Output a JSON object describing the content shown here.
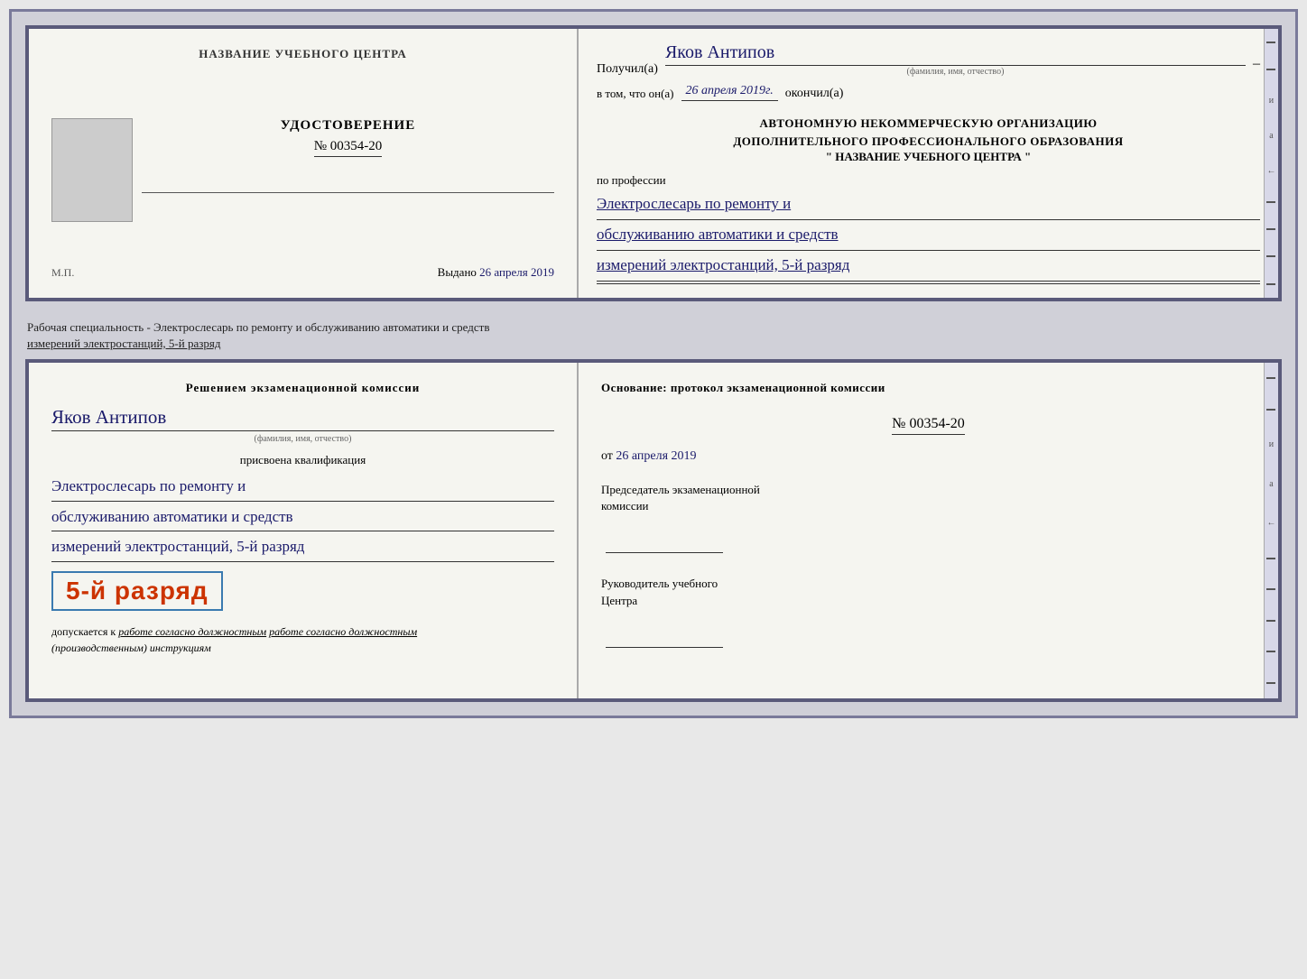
{
  "page": {
    "bg_color": "#d0d0d8"
  },
  "top_doc": {
    "left": {
      "org_name": "НАЗВАНИЕ УЧЕБНОГО ЦЕНТРА",
      "cert_title": "УДОСТОВЕРЕНИЕ",
      "cert_number": "№ 00354-20",
      "issued_label": "Выдано",
      "issued_date": "26 апреля 2019",
      "mp_label": "М.П."
    },
    "right": {
      "recipient_label": "Получил(а)",
      "recipient_name": "Яков Антипов",
      "fio_sub": "(фамилия, имя, отчество)",
      "date_prefix": "в том, что он(а)",
      "date_value": "26 апреля 2019г.",
      "date_suffix": "окончил(а)",
      "org_line1": "АВТОНОМНУЮ НЕКОММЕРЧЕСКУЮ ОРГАНИЗАЦИЮ",
      "org_line2": "ДОПОЛНИТЕЛЬНОГО ПРОФЕССИОНАЛЬНОГО ОБРАЗОВАНИЯ",
      "org_name_quoted": "\" НАЗВАНИЕ УЧЕБНОГО ЦЕНТРА \"",
      "profession_label": "по профессии",
      "profession_line1": "Электрослесарь по ремонту и",
      "profession_line2": "обслуживанию автоматики и средств",
      "profession_line3": "измерений электростанций, 5-й разряд"
    }
  },
  "between_text": {
    "line1": "Рабочая специальность - Электрослесарь по ремонту и обслуживанию автоматики и средств",
    "line2_underline": "измерений электростанций, 5-й разряд"
  },
  "bottom_doc": {
    "left": {
      "commission_title": "Решением экзаменационной комиссии",
      "person_name": "Яков Антипов",
      "fio_sub": "(фамилия, имя, отчество)",
      "qualification_label": "присвоена квалификация",
      "qual_line1": "Электрослесарь по ремонту и",
      "qual_line2": "обслуживанию автоматики и средств",
      "qual_line3": "измерений электростанций, 5-й разряд",
      "grade_text": "5-й разряд",
      "allowed_prefix": "допускается к",
      "allowed_underline": "работе согласно должностным",
      "allowed_italic": "(производственным) инструкциям"
    },
    "right": {
      "basis_label": "Основание: протокол экзаменационной комиссии",
      "protocol_number": "№ 00354-20",
      "protocol_date_prefix": "от",
      "protocol_date_value": "26 апреля 2019",
      "chairman_title_line1": "Председатель экзаменационной",
      "chairman_title_line2": "комиссии",
      "head_title_line1": "Руководитель учебного",
      "head_title_line2": "Центра"
    }
  },
  "deco": {
    "dashes": [
      "-",
      "-",
      "-",
      "и",
      "а",
      "←",
      "-",
      "-",
      "-",
      "-"
    ]
  }
}
